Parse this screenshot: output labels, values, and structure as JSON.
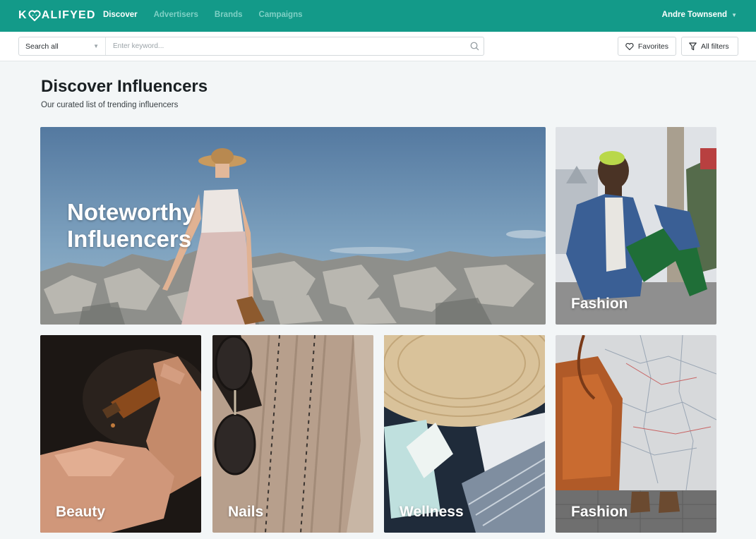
{
  "brand": {
    "logo_text_pre": "K",
    "logo_text_post": "ALIFYED"
  },
  "nav": {
    "links": [
      {
        "label": "Discover",
        "active": true
      },
      {
        "label": "Advertisers",
        "active": false
      },
      {
        "label": "Brands",
        "active": false
      },
      {
        "label": "Campaigns",
        "active": false
      }
    ],
    "user_name": "Andre Townsend"
  },
  "search": {
    "scope": "Search all",
    "placeholder": "Enter keyword...",
    "value": ""
  },
  "toolbar": {
    "favorites_label": "Favorites",
    "filters_label": "All filters"
  },
  "page": {
    "title": "Discover Influencers",
    "subtitle": "Our curated list of trending influencers"
  },
  "cards": [
    {
      "label": "Noteworthy Influencers"
    },
    {
      "label": "Fashion"
    },
    {
      "label": "Beauty"
    },
    {
      "label": "Nails"
    },
    {
      "label": "Wellness"
    },
    {
      "label": "Fashion"
    }
  ],
  "colors": {
    "nav_bg": "#139a89",
    "page_bg": "#f3f6f7",
    "inactive_link": "#7fd0c5"
  }
}
